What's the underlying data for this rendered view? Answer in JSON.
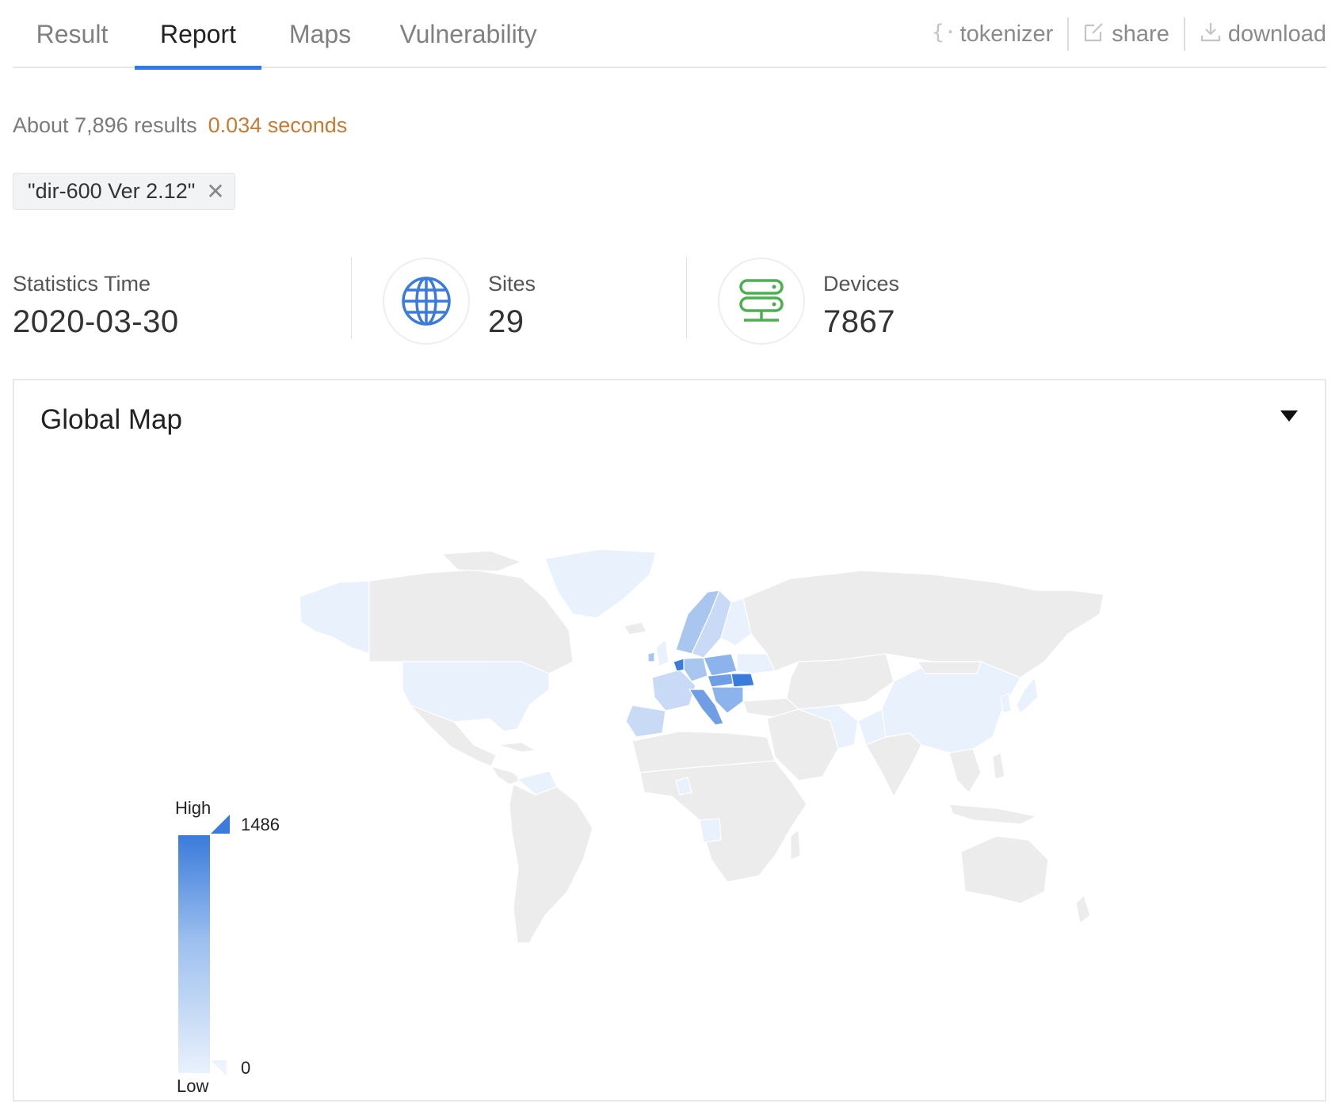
{
  "tabs": [
    {
      "label": "Result",
      "active": false
    },
    {
      "label": "Report",
      "active": true
    },
    {
      "label": "Maps",
      "active": false
    },
    {
      "label": "Vulnerability",
      "active": false
    }
  ],
  "toolbar": {
    "tokenizer_label": "tokenizer",
    "share_label": "share",
    "download_label": "download",
    "tokenizer_icon": "braces-icon",
    "share_icon": "edit-icon",
    "download_icon": "download-icon"
  },
  "search": {
    "results_text": "About 7,896 results",
    "time_text": "0.034 seconds",
    "query_chip": "\"dir-600 Ver 2.12\""
  },
  "stats": {
    "statistics_time_label": "Statistics Time",
    "statistics_time_value": "2020-03-30",
    "sites_label": "Sites",
    "sites_value": "29",
    "devices_label": "Devices",
    "devices_value": "7867"
  },
  "global_map": {
    "title": "Global Map",
    "legend": {
      "high_label": "High",
      "low_label": "Low",
      "max": "1486",
      "min": "0"
    },
    "colors": {
      "base": "#ececec",
      "low": "#e9f1fc",
      "mid": "#a9c6ef",
      "high": "#3b7bdb"
    }
  }
}
